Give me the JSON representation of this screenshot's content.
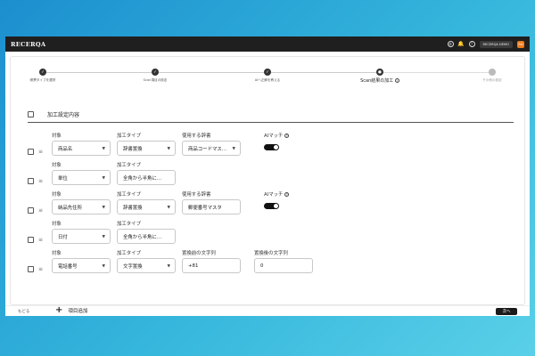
{
  "app": {
    "logo": "RECERQA",
    "user_name": "RECERQA DEMO",
    "user_initials": "RD"
  },
  "stepper": {
    "steps": [
      {
        "label": "帳票タイプを選択",
        "status": "done"
      },
      {
        "label": "Scan項目の設定",
        "status": "done"
      },
      {
        "label": "AIへ正解を教える",
        "status": "done"
      },
      {
        "label": "Scan結果の加工",
        "status": "active"
      },
      {
        "label": "その他の設定",
        "status": "pending"
      }
    ],
    "active_info_icon": "info-icon"
  },
  "table": {
    "header": "加工設定内容"
  },
  "rows": [
    {
      "target_label": "対象",
      "target": "商品名",
      "type_label": "加工タイプ",
      "type": "辞書置換",
      "dict_label": "使用する辞書",
      "dict": "商品コードマス…",
      "ai_label": "AIマッチ",
      "ai_on": true
    },
    {
      "target_label": "対象",
      "target": "単位",
      "type_label": "加工タイプ",
      "type": "全角から半角に…"
    },
    {
      "target_label": "対象",
      "target": "納品先住所",
      "type_label": "加工タイプ",
      "type": "辞書置換",
      "dict_label": "使用する辞書",
      "dict": "郵便番号マスタ",
      "ai_label": "AIマッチ",
      "ai_on": true
    },
    {
      "target_label": "対象",
      "target": "日付",
      "type_label": "加工タイプ",
      "type": "全角から半角に…"
    },
    {
      "target_label": "対象",
      "target": "電話番号",
      "type_label": "加工タイプ",
      "type": "文字置換",
      "before_label": "置換前の文字列",
      "before": "+81",
      "after_label": "置換後の文字列",
      "after": "0"
    }
  ],
  "add_item_label": "項目追加",
  "footer": {
    "back_label": "もどる",
    "next_label": "次へ"
  }
}
